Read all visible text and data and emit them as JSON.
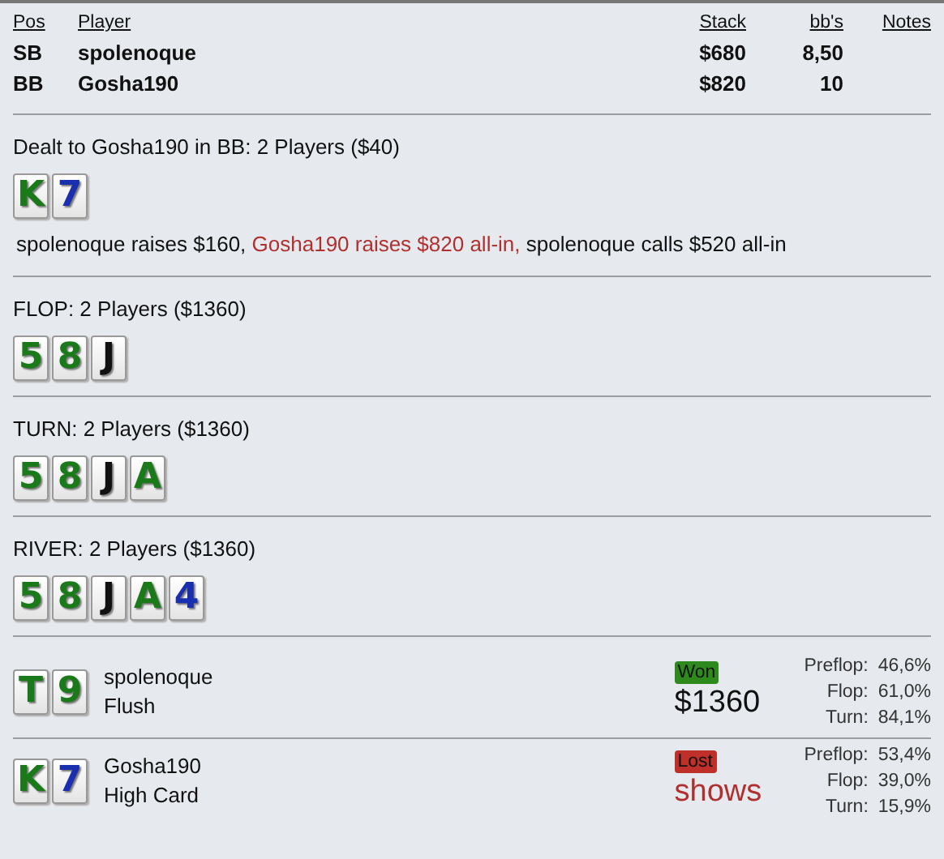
{
  "players_table": {
    "columns": [
      "Pos",
      "Player",
      "Stack",
      "bb's",
      "Notes"
    ],
    "rows": [
      {
        "pos": "SB",
        "player": "spolenoque",
        "stack": "$680",
        "bbs": "8,50"
      },
      {
        "pos": "BB",
        "player": "Gosha190",
        "stack": "$820",
        "bbs": "10"
      }
    ]
  },
  "streets": [
    {
      "title": "Dealt to Gosha190 in BB: 2 Players ($40)",
      "cards": [
        {
          "rank": "K",
          "color": "#1a7a1a"
        },
        {
          "rank": "7",
          "color": "#1a2fb0"
        }
      ],
      "action": [
        {
          "text": "spolenoque raises $160, ",
          "highlight": false
        },
        {
          "text": "Gosha190 raises $820 all-in,",
          "highlight": true
        },
        {
          "text": " spolenoque calls $520 all-in",
          "highlight": false
        }
      ]
    },
    {
      "title": "FLOP: 2 Players ($1360)",
      "cards": [
        {
          "rank": "5",
          "color": "#1a7a1a"
        },
        {
          "rank": "8",
          "color": "#1a7a1a"
        },
        {
          "rank": "J",
          "color": "#111111"
        }
      ]
    },
    {
      "title": "TURN: 2 Players ($1360)",
      "cards": [
        {
          "rank": "5",
          "color": "#1a7a1a"
        },
        {
          "rank": "8",
          "color": "#1a7a1a"
        },
        {
          "rank": "J",
          "color": "#111111"
        },
        {
          "rank": "A",
          "color": "#1a7a1a"
        }
      ]
    },
    {
      "title": "RIVER: 2 Players ($1360)",
      "cards": [
        {
          "rank": "5",
          "color": "#1a7a1a"
        },
        {
          "rank": "8",
          "color": "#1a7a1a"
        },
        {
          "rank": "J",
          "color": "#111111"
        },
        {
          "rank": "A",
          "color": "#1a7a1a"
        },
        {
          "rank": "4",
          "color": "#1a2fb0"
        }
      ]
    }
  ],
  "results": [
    {
      "cards": [
        {
          "rank": "T",
          "color": "#1a7a1a"
        },
        {
          "rank": "9",
          "color": "#1a7a1a"
        }
      ],
      "player": "spolenoque",
      "hand": "Flush",
      "kind": "won",
      "badge": "Won",
      "amount": "$1360",
      "equity": [
        {
          "label": "Preflop:",
          "value": "46,6%"
        },
        {
          "label": "Flop:",
          "value": "61,0%"
        },
        {
          "label": "Turn:",
          "value": "84,1%"
        }
      ]
    },
    {
      "cards": [
        {
          "rank": "K",
          "color": "#1a7a1a"
        },
        {
          "rank": "7",
          "color": "#1a2fb0"
        }
      ],
      "player": "Gosha190",
      "hand": "High Card",
      "kind": "lost",
      "badge": "Lost",
      "amount": "shows",
      "equity": [
        {
          "label": "Preflop:",
          "value": "53,4%"
        },
        {
          "label": "Flop:",
          "value": "39,0%"
        },
        {
          "label": "Turn:",
          "value": "15,9%"
        }
      ]
    }
  ]
}
